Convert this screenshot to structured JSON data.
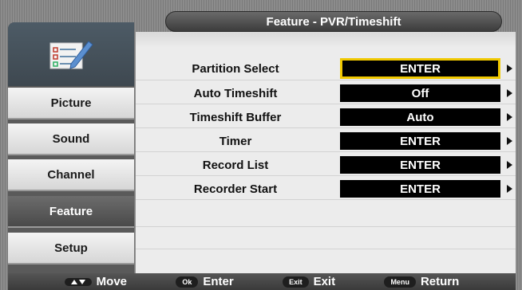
{
  "header": {
    "title": "Feature - PVR/Timeshift"
  },
  "sidebar": {
    "icon": "checklist-pencil-icon",
    "items": [
      {
        "label": "Picture",
        "active": false
      },
      {
        "label": "Sound",
        "active": false
      },
      {
        "label": "Channel",
        "active": false
      },
      {
        "label": "Feature",
        "active": true
      },
      {
        "label": "Setup",
        "active": false
      }
    ]
  },
  "settings": [
    {
      "label": "Partition Select",
      "value": "ENTER",
      "focused": true
    },
    {
      "label": "Auto Timeshift",
      "value": "Off",
      "focused": false
    },
    {
      "label": "Timeshift Buffer",
      "value": "Auto",
      "focused": false
    },
    {
      "label": "Timer",
      "value": "ENTER",
      "focused": false
    },
    {
      "label": "Record List",
      "value": "ENTER",
      "focused": false
    },
    {
      "label": "Recorder Start",
      "value": "ENTER",
      "focused": false
    }
  ],
  "footer": {
    "move": {
      "key": "",
      "label": "Move"
    },
    "enter": {
      "key": "Ok",
      "label": "Enter"
    },
    "exit": {
      "key": "Exit",
      "label": "Exit"
    },
    "return": {
      "key": "Menu",
      "label": "Return"
    }
  },
  "colors": {
    "focus_border": "#f0c800",
    "value_bg": "#000000",
    "active_menu_bg": "#5a5a5a"
  }
}
